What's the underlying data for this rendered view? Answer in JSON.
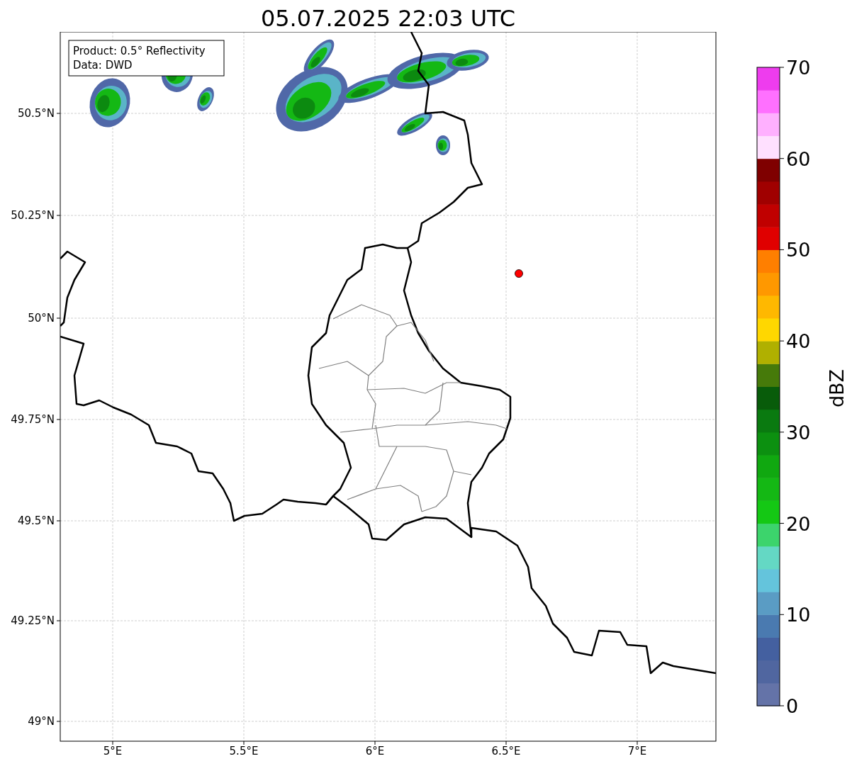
{
  "title": "05.07.2025 22:03 UTC",
  "map": {
    "legend": [
      "Product: 0.5° Reflectivity",
      "Data: DWD"
    ],
    "xticks": [
      "5°E",
      "5.5°E",
      "6°E",
      "6.5°E",
      "7°E"
    ],
    "yticks": [
      "50.5°N",
      "50.25°N",
      "50°N",
      "49.75°N",
      "49.5°N",
      "49.25°N",
      "49°N"
    ]
  },
  "colorbar": {
    "label": "dBZ",
    "ticks": [
      "70",
      "60",
      "50",
      "40",
      "30",
      "20",
      "10",
      "0"
    ],
    "bins": [
      {
        "color": "#6473a8"
      },
      {
        "color": "#5066a0"
      },
      {
        "color": "#4460a0"
      },
      {
        "color": "#4a7ab0"
      },
      {
        "color": "#5a9cc4"
      },
      {
        "color": "#64c4dc"
      },
      {
        "color": "#64d8c4"
      },
      {
        "color": "#3cd46c"
      },
      {
        "color": "#14c814"
      },
      {
        "color": "#14b814"
      },
      {
        "color": "#10a810"
      },
      {
        "color": "#0c9010"
      },
      {
        "color": "#0a7a10"
      },
      {
        "color": "#085c0a"
      },
      {
        "color": "#467a0a"
      },
      {
        "color": "#b0b000"
      },
      {
        "color": "#ffd700"
      },
      {
        "color": "#ffb800"
      },
      {
        "color": "#ff9800"
      },
      {
        "color": "#ff7f00"
      },
      {
        "color": "#e00000"
      },
      {
        "color": "#c00000"
      },
      {
        "color": "#a00000"
      },
      {
        "color": "#7f0000"
      },
      {
        "color": "#ffe0ff"
      },
      {
        "color": "#ffb0ff"
      },
      {
        "color": "#ff70ff"
      },
      {
        "color": "#ee3cee"
      }
    ]
  }
}
